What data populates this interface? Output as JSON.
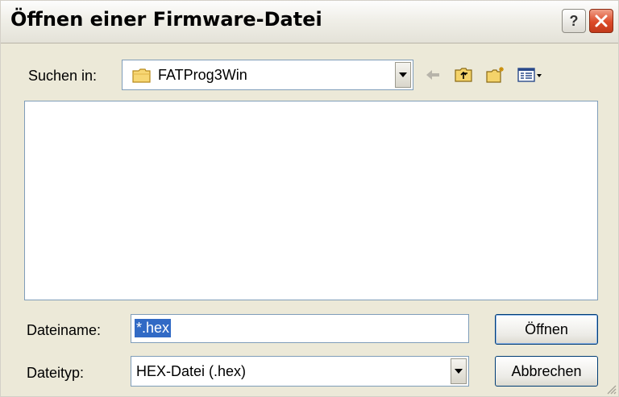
{
  "dialog": {
    "title": "Öffnen einer Firmware-Datei"
  },
  "lookin": {
    "label": "Suchen in:",
    "value": "FATProg3Win"
  },
  "filename": {
    "label": "Dateiname:",
    "value": "*.hex"
  },
  "filetype": {
    "label": "Dateityp:",
    "value": "HEX-Datei (.hex)"
  },
  "buttons": {
    "open": "Öffnen",
    "cancel": "Abbrechen"
  },
  "icons": {
    "help": "help-icon",
    "close": "close-icon",
    "folder": "folder-icon",
    "back": "back-arrow-icon",
    "up": "up-folder-icon",
    "new_folder": "new-folder-icon",
    "view_menu": "view-menu-icon"
  }
}
